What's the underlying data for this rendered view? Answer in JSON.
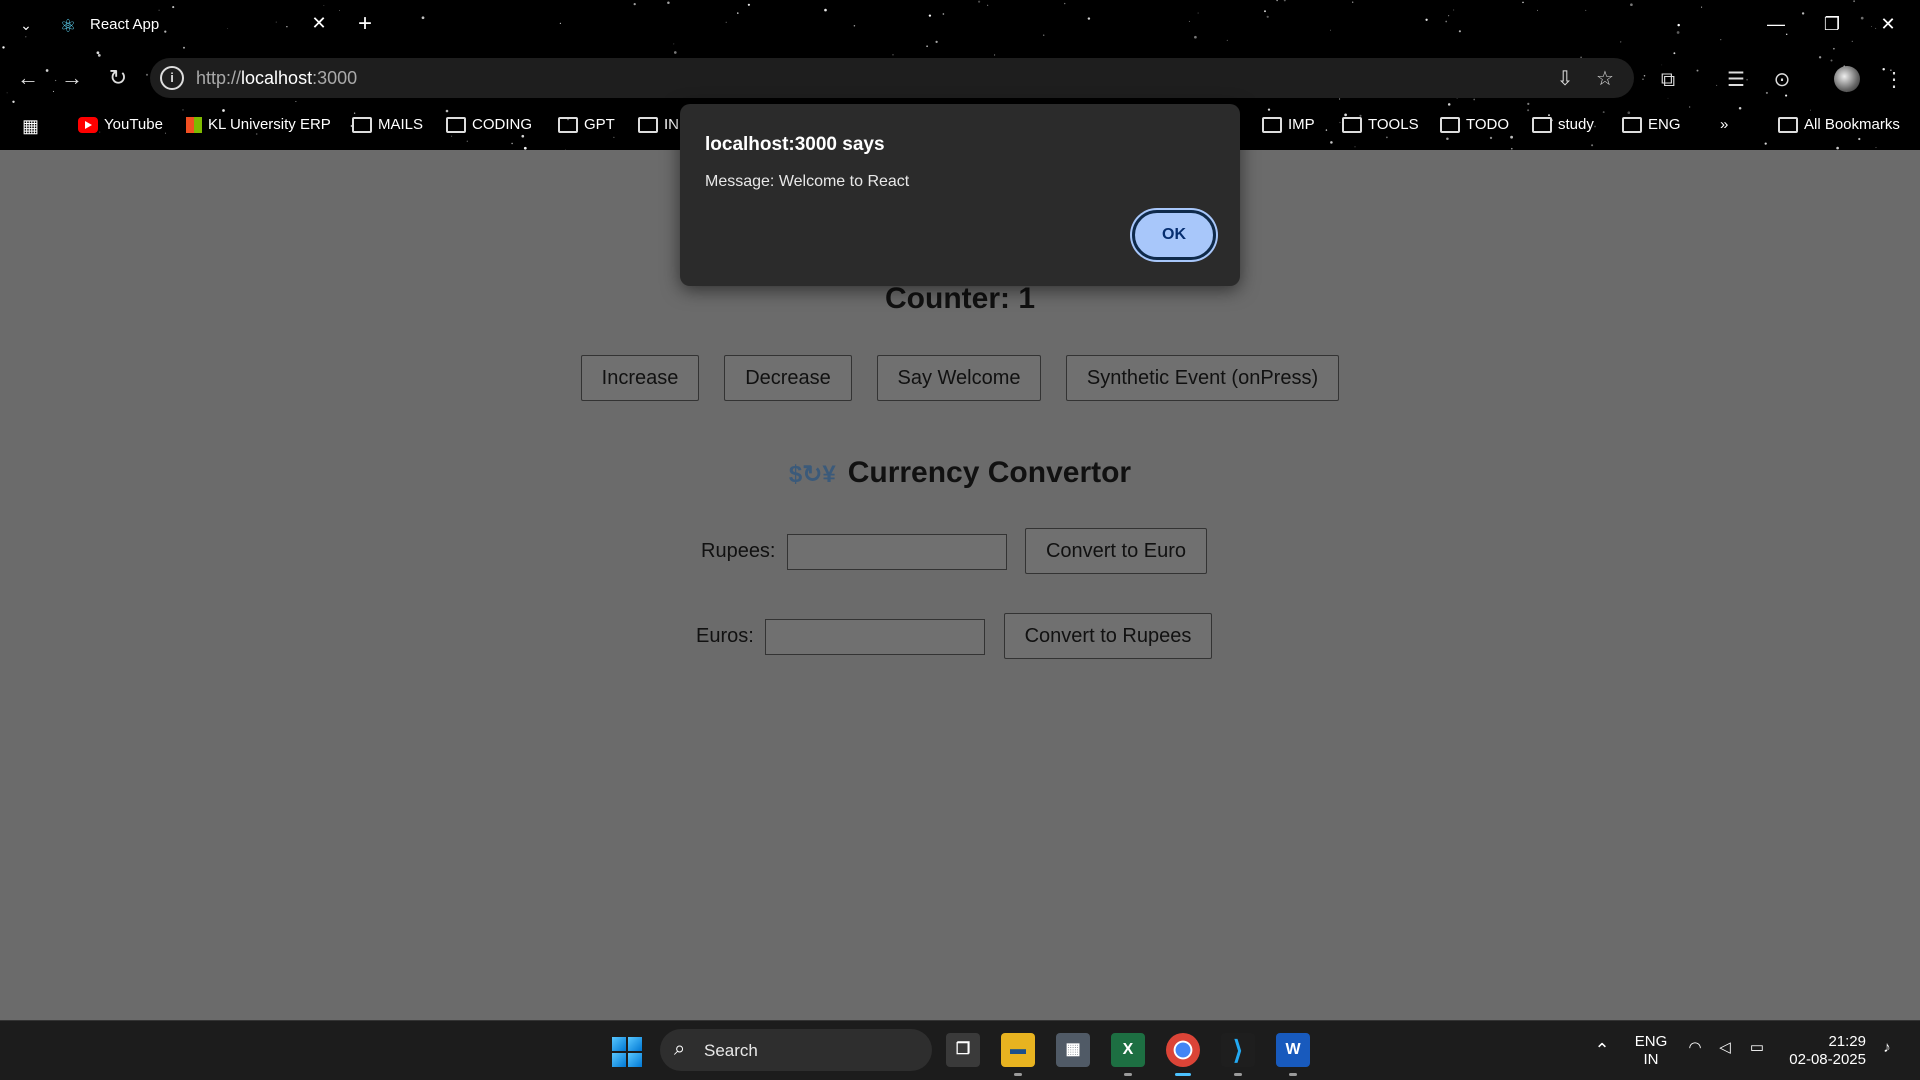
{
  "browser": {
    "tab_title": "React App",
    "url_scheme": "http://",
    "url_host": "localhost",
    "url_port": ":3000",
    "bookmarks": [
      {
        "label": "YouTube",
        "icon": "youtube-icon"
      },
      {
        "label": "KL University ERP",
        "icon": "microsoft-icon"
      },
      {
        "label": "MAILS",
        "icon": "folder-icon"
      },
      {
        "label": "CODING",
        "icon": "folder-icon"
      },
      {
        "label": "GPT",
        "icon": "folder-icon"
      },
      {
        "label": "IN",
        "icon": "folder-icon"
      },
      {
        "label": "IMP",
        "icon": "folder-icon"
      },
      {
        "label": "TOOLS",
        "icon": "folder-icon"
      },
      {
        "label": "TODO",
        "icon": "folder-icon"
      },
      {
        "label": "study",
        "icon": "folder-icon"
      },
      {
        "label": "ENG",
        "icon": "folder-icon"
      }
    ],
    "more_bookmarks": "»",
    "all_bookmarks": "All Bookmarks"
  },
  "dialog": {
    "title": "localhost:3000 says",
    "message": "Message: Welcome to React",
    "ok_label": "OK"
  },
  "page": {
    "counter_text": "Counter: 1",
    "buttons": {
      "increase": "Increase",
      "decrease": "Decrease",
      "say_welcome": "Say Welcome",
      "synthetic": "Synthetic Event (onPress)"
    },
    "currency": {
      "title": "Currency Convertor",
      "icon_glyph": "$↻¥",
      "rupees_label": "Rupees:",
      "rupees_value": "",
      "convert_euro": "Convert to Euro",
      "euros_label": "Euros:",
      "euros_value": "",
      "convert_rupees": "Convert to Rupees"
    }
  },
  "taskbar": {
    "search_label": "Search",
    "lang_line1": "ENG",
    "lang_line2": "IN",
    "time": "21:29",
    "date": "02-08-2025"
  },
  "colors": {
    "page_bg": "#6b6b6b",
    "dialog_bg": "#2b2b2b",
    "ok_button": "#a8c7fa",
    "taskbar_bg": "#1c1c1c"
  }
}
